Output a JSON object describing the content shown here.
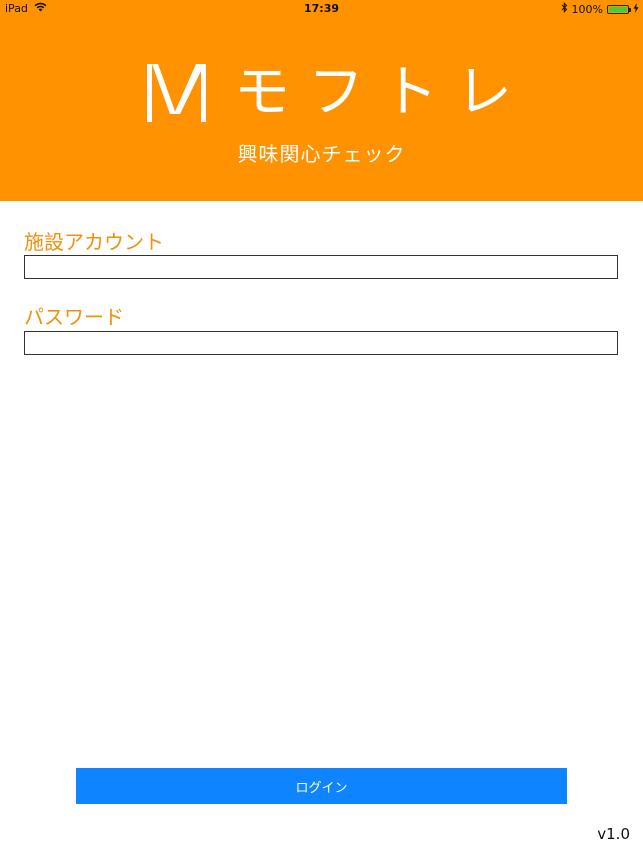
{
  "status_bar": {
    "device": "iPad",
    "time": "17:39",
    "battery_percent": "100%",
    "battery_level": 1.0
  },
  "header": {
    "logo_text": "モフトレ",
    "subtitle": "興味関心チェック",
    "background_color": "#FF9200"
  },
  "form": {
    "account_label": "施設アカウント",
    "account_value": "",
    "password_label": "パスワード",
    "password_value": "",
    "label_color": "#F0900E"
  },
  "login": {
    "label": "ログイン",
    "color": "#0E84FF"
  },
  "version": "v1.0",
  "icons": {
    "wifi": "wifi-icon",
    "bluetooth": "bluetooth-icon",
    "battery": "battery-icon",
    "charging": "charging-bolt-icon",
    "logo": "moftre-logo-icon"
  }
}
